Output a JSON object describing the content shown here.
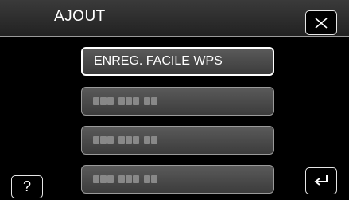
{
  "header": {
    "title": "AJOUT",
    "close_icon": "close-x-icon"
  },
  "list": {
    "items": [
      {
        "label": "ENREG. FACILE WPS",
        "selected": true
      },
      {
        "masked_groups": [
          3,
          3,
          2
        ]
      },
      {
        "masked_groups": [
          3,
          3,
          2
        ]
      },
      {
        "masked_groups": [
          3,
          3,
          2
        ]
      }
    ]
  },
  "footer": {
    "help_label": "?",
    "back_icon": "return-arrow-icon"
  },
  "colors": {
    "background": "#000000",
    "item_fill": "#4a4a4a",
    "text": "#ffffff",
    "border": "#9a9a9a"
  }
}
